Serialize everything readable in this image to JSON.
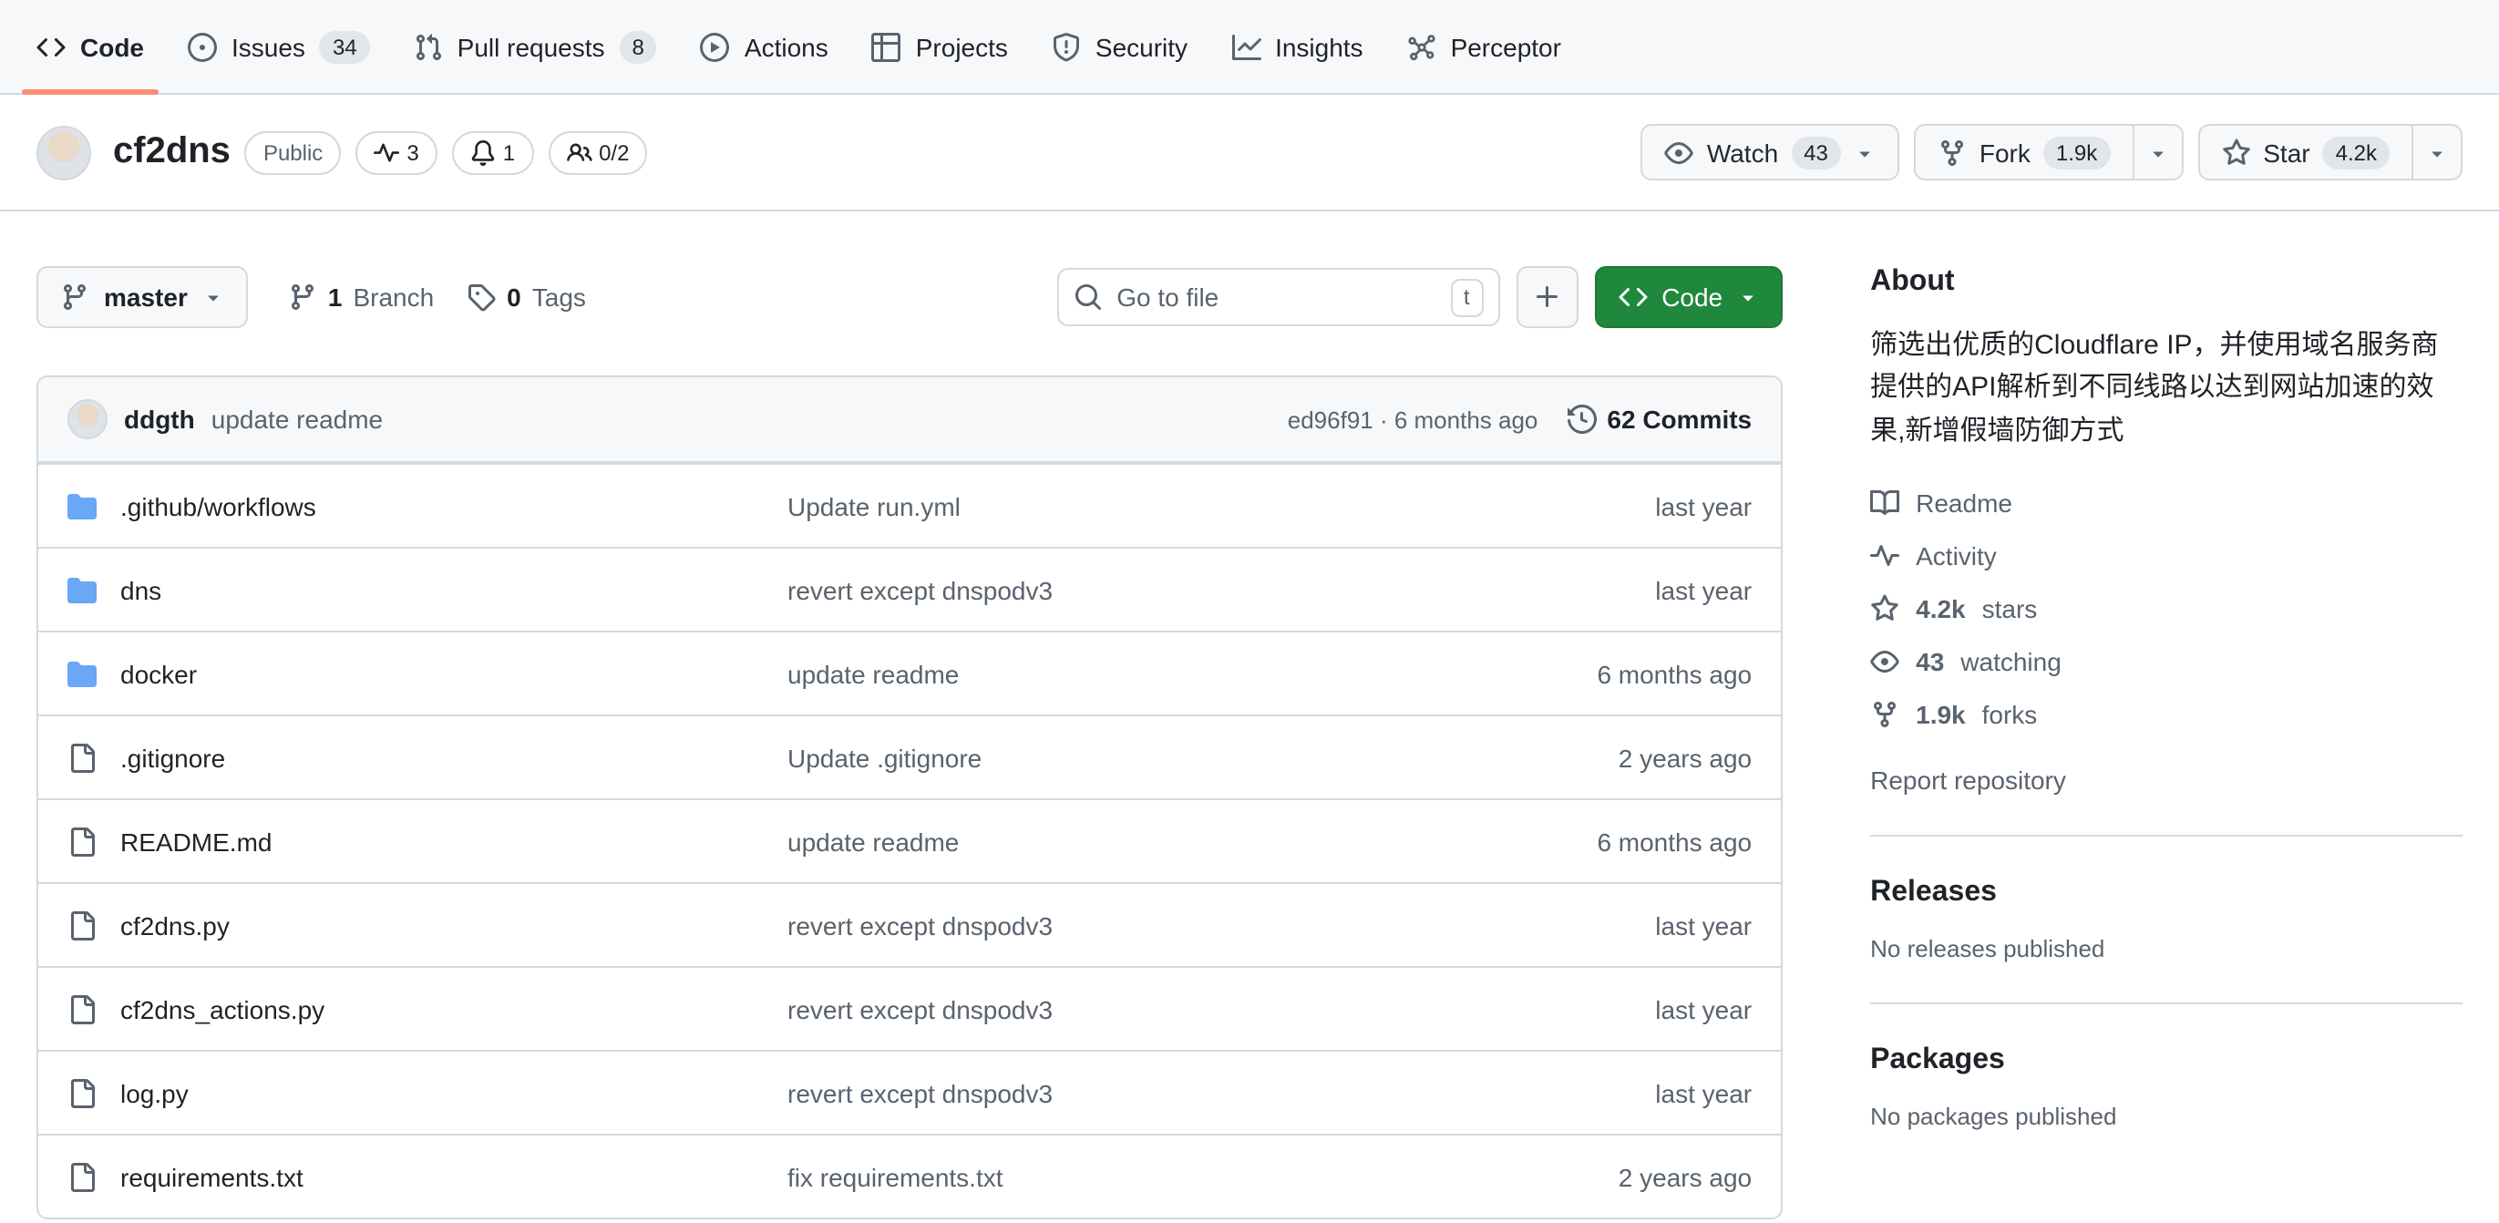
{
  "colors": {
    "accent_green": "#1f883d",
    "tab_underline": "#fd8c73",
    "folder_blue": "#6aa7f4",
    "nav_bg": "#f6f8fa",
    "border": "#d1d9e0",
    "text_primary": "#1f2328",
    "text_muted": "#59636e"
  },
  "nav": {
    "tabs": [
      {
        "label": "Code"
      },
      {
        "label": "Issues",
        "count": "34"
      },
      {
        "label": "Pull requests",
        "count": "8"
      },
      {
        "label": "Actions"
      },
      {
        "label": "Projects"
      },
      {
        "label": "Security"
      },
      {
        "label": "Insights"
      },
      {
        "label": "Perceptor"
      }
    ]
  },
  "repo": {
    "name": "cf2dns",
    "visibility": "Public",
    "pulse_count": "3",
    "bell_count": "1",
    "people_count": "0/2"
  },
  "header_actions": {
    "watch_label": "Watch",
    "watch_count": "43",
    "fork_label": "Fork",
    "fork_count": "1.9k",
    "star_label": "Star",
    "star_count": "4.2k"
  },
  "toolbar": {
    "branch": "master",
    "branch_count": "1",
    "branch_word": "Branch",
    "tag_count": "0",
    "tag_word": "Tags",
    "goto_placeholder": "Go to file",
    "goto_key": "t",
    "code_label": "Code"
  },
  "commit_bar": {
    "author": "ddgth",
    "message": "update readme",
    "sha_line": "ed96f91 · 6 months ago",
    "commits": "62 Commits"
  },
  "files": [
    {
      "type": "folder",
      "name": ".github/workflows",
      "message": "Update run.yml",
      "date": "last year"
    },
    {
      "type": "folder",
      "name": "dns",
      "message": "revert except dnspodv3",
      "date": "last year"
    },
    {
      "type": "folder",
      "name": "docker",
      "message": "update readme",
      "date": "6 months ago"
    },
    {
      "type": "file",
      "name": ".gitignore",
      "message": "Update .gitignore",
      "date": "2 years ago"
    },
    {
      "type": "file",
      "name": "README.md",
      "message": "update readme",
      "date": "6 months ago"
    },
    {
      "type": "file",
      "name": "cf2dns.py",
      "message": "revert except dnspodv3",
      "date": "last year"
    },
    {
      "type": "file",
      "name": "cf2dns_actions.py",
      "message": "revert except dnspodv3",
      "date": "last year"
    },
    {
      "type": "file",
      "name": "log.py",
      "message": "revert except dnspodv3",
      "date": "last year"
    },
    {
      "type": "file",
      "name": "requirements.txt",
      "message": "fix requirements.txt",
      "date": "2 years ago"
    }
  ],
  "sidebar": {
    "about_title": "About",
    "about_description": "筛选出优质的Cloudflare IP，并使用域名服务商提供的API解析到不同线路以达到网站加速的效果,新增假墙防御方式",
    "meta": [
      {
        "icon": "book",
        "text": "Readme"
      },
      {
        "icon": "pulse",
        "text": "Activity"
      },
      {
        "icon": "star",
        "bold": "4.2k",
        "text": "stars"
      },
      {
        "icon": "eye",
        "bold": "43",
        "text": "watching"
      },
      {
        "icon": "fork",
        "bold": "1.9k",
        "text": "forks"
      }
    ],
    "report": "Report repository",
    "releases_title": "Releases",
    "releases_empty": "No releases published",
    "packages_title": "Packages",
    "packages_empty": "No packages published"
  }
}
